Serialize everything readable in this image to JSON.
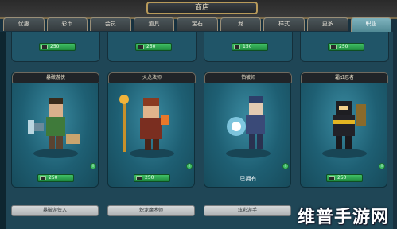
{
  "header": {
    "title": "商店"
  },
  "tabs": [
    {
      "label": "优惠",
      "active": false
    },
    {
      "label": "彩币",
      "active": false
    },
    {
      "label": "会员",
      "active": false
    },
    {
      "label": "道具",
      "active": false
    },
    {
      "label": "宝石",
      "active": false
    },
    {
      "label": "龙",
      "active": false
    },
    {
      "label": "样式",
      "active": false
    },
    {
      "label": "更多",
      "active": false
    },
    {
      "label": "职业",
      "active": true
    }
  ],
  "top_row_prices": [
    "250",
    "250",
    "150",
    "250"
  ],
  "cards": [
    {
      "name": "暴破游侠",
      "price": "250",
      "status": "price",
      "button": "暴破游侠入"
    },
    {
      "name": "火龙法师",
      "price": "250",
      "status": "price",
      "button": "炽龙魔术师"
    },
    {
      "name": "怕被师",
      "price": "",
      "status": "已拥有",
      "button": "炫彩游手"
    },
    {
      "name": "霜虹忍者",
      "price": "250",
      "status": "price",
      "button": ""
    }
  ],
  "watermark": "维普手游网",
  "colors": {
    "accent": "#4e8792",
    "price_green": "#2aa350",
    "panel": "#1f4656"
  }
}
